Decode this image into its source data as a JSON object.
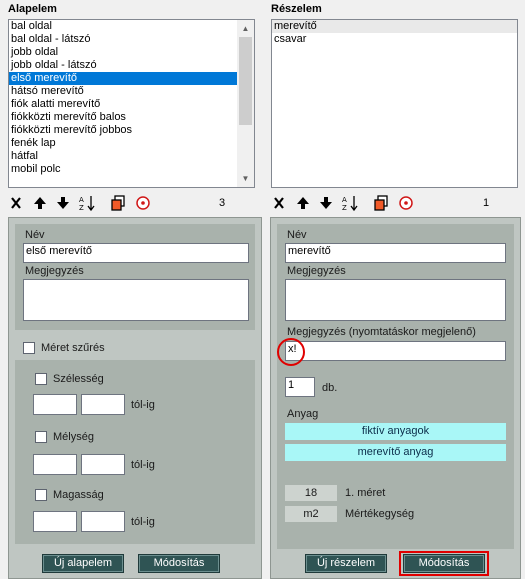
{
  "left": {
    "header": "Alapelem",
    "items": [
      "bal oldal",
      "bal oldal - látszó",
      "jobb oldal",
      "jobb oldal - látszó",
      "első merevítő",
      "hátsó merevítő",
      "fiók alatti merevítő",
      "fiókközti merevítő balos",
      "fiókközti merevítő jobbos",
      "fenék lap",
      "hátfal",
      "mobil polc"
    ],
    "selected_index": 4,
    "count": "3",
    "form": {
      "name_label": "Név",
      "name_value": "első merevítő",
      "note_label": "Megjegyzés",
      "note_value": "",
      "size_filter_label": "Méret szűrés",
      "width_label": "Szélesség",
      "depth_label": "Mélység",
      "height_label": "Magasság",
      "range_label": "tól-ig"
    },
    "new_button": "Új alapelem",
    "modify_button": "Módosítás"
  },
  "right": {
    "header": "Részelem",
    "items": [
      "merevítő",
      "csavar"
    ],
    "selected_index": 0,
    "count": "1",
    "form": {
      "name_label": "Név",
      "name_value": "merevítő",
      "note_label": "Megjegyzés",
      "note_value": "",
      "print_note_label": "Megjegyzés (nyomtatáskor megjelenő)",
      "print_note_value": "x!",
      "qty_value": "1",
      "qty_unit": "db.",
      "material_label": "Anyag",
      "material_buttons": [
        "fiktív anyagok",
        "merevítő anyag"
      ],
      "size_value": "18",
      "size_label": "1. méret",
      "unit_value": "m2",
      "unit_label": "Mértékegység"
    },
    "new_button": "Új részelem",
    "modify_button": "Módosítás"
  },
  "toolbar_icons": [
    "delete-x-icon",
    "arrow-up-icon",
    "arrow-down-icon",
    "sort-az-icon",
    "copy-icon",
    "target-icon"
  ],
  "colors": {
    "panel": "#bfc6c2",
    "group": "#a9b2ac",
    "dark_button": "#2f5454",
    "cyan_button": "#a9f7f7",
    "selection": "#0078d7",
    "highlight_red": "#e00000"
  }
}
